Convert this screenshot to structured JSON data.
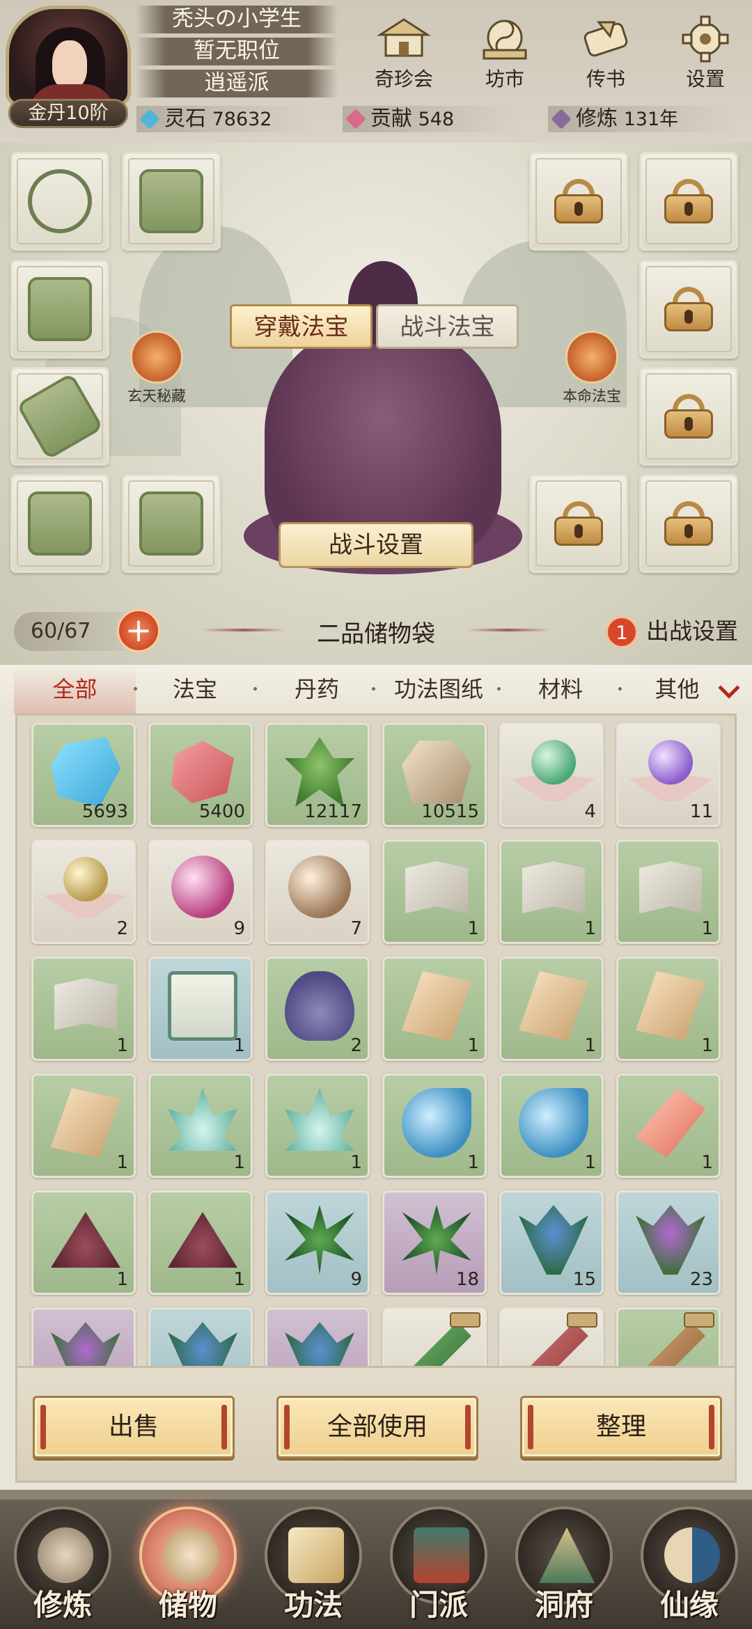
{
  "header": {
    "player_name": "秃头の小学生",
    "position": "暂无职位",
    "sect": "逍遥派",
    "realm": "金丹10阶",
    "top_buttons": [
      {
        "label": "奇珍会",
        "icon": "treasure-pavilion-icon"
      },
      {
        "label": "坊市",
        "icon": "market-icon"
      },
      {
        "label": "传书",
        "icon": "letter-scroll-icon"
      },
      {
        "label": "设置",
        "icon": "gear-icon"
      }
    ],
    "resources": [
      {
        "name": "灵石",
        "value": "78632",
        "color": "#4fb6d9"
      },
      {
        "name": "贡献",
        "value": "548",
        "color": "#d96a8a"
      },
      {
        "name": "修炼",
        "value": "131年",
        "color": "#8a6a9a"
      }
    ]
  },
  "equip": {
    "tabs": [
      "穿戴法宝",
      "战斗法宝"
    ],
    "active_tab": "穿戴法宝",
    "left_special": "玄天秘藏",
    "right_special": "本命法宝",
    "battle_button": "战斗设置"
  },
  "bag": {
    "capacity": "60/67",
    "title": "二品储物袋",
    "battle_setting": "出战设置",
    "battle_badge": "1"
  },
  "categories": [
    "全部",
    "法宝",
    "丹药",
    "功法图纸",
    "材料",
    "其他"
  ],
  "active_category": "全部",
  "items": [
    {
      "icon": "crystal",
      "bg": "green",
      "count": "5693"
    },
    {
      "icon": "ruby",
      "bg": "green",
      "count": "5400"
    },
    {
      "icon": "herb",
      "bg": "green",
      "count": "12117"
    },
    {
      "icon": "ore",
      "bg": "green",
      "count": "10515"
    },
    {
      "icon": "pearl-green",
      "bg": "grey",
      "count": "4"
    },
    {
      "icon": "pearl-purple",
      "bg": "grey",
      "count": "11"
    },
    {
      "icon": "pearl-gold",
      "bg": "grey",
      "count": "2"
    },
    {
      "icon": "orb-pink",
      "bg": "grey",
      "count": "9"
    },
    {
      "icon": "orb-tan",
      "bg": "grey",
      "count": "7"
    },
    {
      "icon": "book",
      "bg": "green",
      "count": "1"
    },
    {
      "icon": "book",
      "bg": "green",
      "count": "1"
    },
    {
      "icon": "book",
      "bg": "green",
      "count": "1"
    },
    {
      "icon": "book",
      "bg": "green",
      "count": "1"
    },
    {
      "icon": "scroll",
      "bg": "blue",
      "count": "1"
    },
    {
      "icon": "vase",
      "bg": "green",
      "count": "2"
    },
    {
      "icon": "shard",
      "bg": "green",
      "count": "1"
    },
    {
      "icon": "shard",
      "bg": "green",
      "count": "1"
    },
    {
      "icon": "shard",
      "bg": "green",
      "count": "1"
    },
    {
      "icon": "shard",
      "bg": "green",
      "count": "1"
    },
    {
      "icon": "lotus",
      "bg": "green",
      "count": "1"
    },
    {
      "icon": "lotus",
      "bg": "green",
      "count": "1"
    },
    {
      "icon": "drop",
      "bg": "green",
      "count": "1"
    },
    {
      "icon": "drop",
      "bg": "green",
      "count": "1"
    },
    {
      "icon": "redshard",
      "bg": "green",
      "count": "1"
    },
    {
      "icon": "powder",
      "bg": "green",
      "count": "1"
    },
    {
      "icon": "powder",
      "bg": "green",
      "count": "1"
    },
    {
      "icon": "plant2",
      "bg": "blue",
      "count": "9"
    },
    {
      "icon": "plant2",
      "bg": "purple",
      "count": "18"
    },
    {
      "icon": "iris",
      "bg": "blue",
      "count": "15"
    },
    {
      "icon": "violet",
      "bg": "blue",
      "count": "23"
    },
    {
      "icon": "violet",
      "bg": "purple",
      "count": ""
    },
    {
      "icon": "iris",
      "bg": "blue",
      "count": ""
    },
    {
      "icon": "iris",
      "bg": "purple",
      "count": ""
    },
    {
      "icon": "sword",
      "bg": "grey",
      "count": ""
    },
    {
      "icon": "sword-red",
      "bg": "grey",
      "count": ""
    },
    {
      "icon": "sword-tan",
      "bg": "green",
      "count": ""
    }
  ],
  "actions": [
    "出售",
    "全部使用",
    "整理"
  ],
  "nav": [
    {
      "label": "修炼",
      "icon": "cultivate-icon"
    },
    {
      "label": "储物",
      "icon": "storage-bag-icon"
    },
    {
      "label": "功法",
      "icon": "technique-scroll-icon"
    },
    {
      "label": "门派",
      "icon": "sect-gate-icon"
    },
    {
      "label": "洞府",
      "icon": "cave-mountain-icon"
    },
    {
      "label": "仙缘",
      "icon": "immortal-taiji-icon"
    }
  ],
  "active_nav": "储物"
}
